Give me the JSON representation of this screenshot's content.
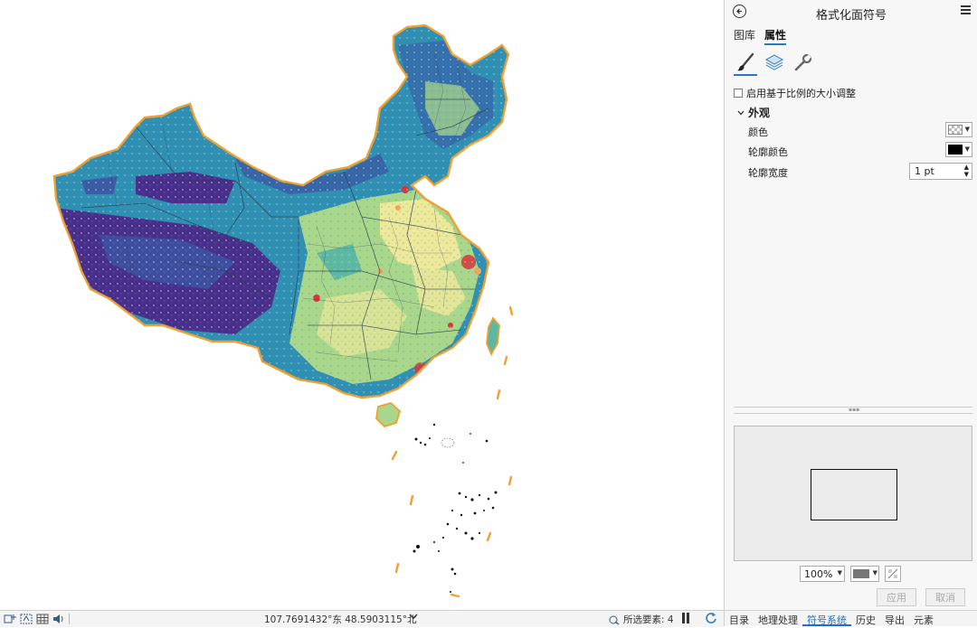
{
  "panel": {
    "title": "格式化面符号",
    "tabs": [
      {
        "label": "图库",
        "active": false
      },
      {
        "label": "属性",
        "active": true
      }
    ],
    "icon_tabs": [
      "paintbrush-icon",
      "layers-icon",
      "wrench-icon"
    ],
    "scale_checkbox": {
      "label": "启用基于比例的大小调整",
      "checked": false
    },
    "appearance": {
      "header": "外观",
      "color_label": "颜色",
      "outline_color_label": "轮廓颜色",
      "outline_color": "#000000",
      "outline_width_label": "轮廓宽度",
      "outline_width_value": "1 pt"
    },
    "preview": {
      "zoom": "100%",
      "background": "#777777"
    },
    "apply_label": "应用",
    "cancel_label": "取消"
  },
  "status_bar": {
    "coordinates": "107.7691432°东 48.5903115°北",
    "selected_features": "所选要素: 4"
  },
  "bottom_tabs": [
    {
      "label": "目录",
      "active": false
    },
    {
      "label": "地理处理",
      "active": false
    },
    {
      "label": "符号系统",
      "active": true
    },
    {
      "label": "历史",
      "active": false
    },
    {
      "label": "导出",
      "active": false
    },
    {
      "label": "元素",
      "active": false
    }
  ],
  "map": {
    "palette": [
      "#4b2f8f",
      "#3b5aa8",
      "#2f8fb5",
      "#5cb8a3",
      "#a8d68a",
      "#eee89a",
      "#f2a65a",
      "#d9353b"
    ],
    "outline_color": "#f0a030"
  }
}
